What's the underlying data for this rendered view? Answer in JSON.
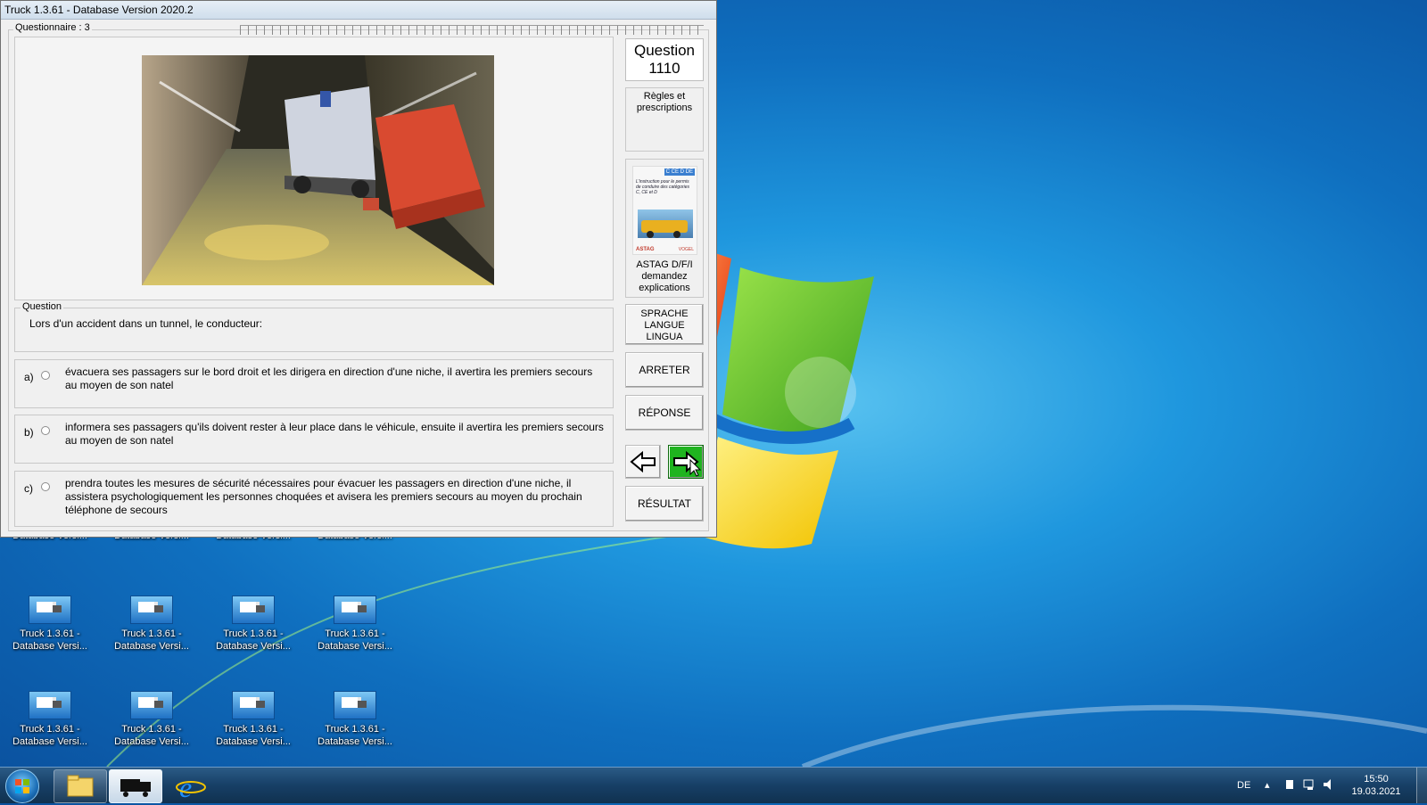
{
  "window": {
    "title": "Truck 1.3.61 - Database Version 2020.2"
  },
  "questionnaire": {
    "label": "Questionnaire : 3"
  },
  "question_panel": {
    "number_label": "Question",
    "number": "1110",
    "category": "Règles et prescriptions",
    "legend": "Question",
    "text": "Lors d'un accident dans un tunnel, le conducteur:"
  },
  "answers": [
    {
      "letter": "a)",
      "text": "évacuera ses passagers sur le bord droit et les dirigera en direction d'une niche, il avertira les premiers secours au moyen de son natel",
      "selected": false
    },
    {
      "letter": "b)",
      "text": "informera ses passagers qu'ils doivent rester à leur place dans le véhicule, ensuite il avertira les premiers secours au moyen de son natel",
      "selected": false
    },
    {
      "letter": "c)",
      "text": "prendra toutes les mesures de sécurité nécessaires pour évacuer les passagers en direction d'une niche, il assistera psychologiquement les personnes choquées et avisera les premiers secours au moyen du prochain téléphone de secours",
      "selected": false
    }
  ],
  "book": {
    "cover_badge": "C CE D DE",
    "cover_text": "L'instruction pour le permis de conduire des catégories C, CE et D",
    "publisher_left": "ASTAG",
    "publisher_right": "VOGEL",
    "caption_1": "ASTAG D/F/I",
    "caption_2": "demandez",
    "caption_3": "explications"
  },
  "buttons": {
    "language_1": "SPRACHE",
    "language_2": "LANGUE",
    "language_3": "LINGUA",
    "stop": "ARRETER",
    "answer": "RÉPONSE",
    "result": "RÉSULTAT"
  },
  "desktop_icons": [
    {
      "line1": "",
      "line2": "Database Versi..."
    },
    {
      "line1": "",
      "line2": "Database Versi..."
    },
    {
      "line1": "",
      "line2": "Database Versi..."
    },
    {
      "line1": "",
      "line2": "Database Versi..."
    },
    {
      "line1": "Truck 1.3.61 -",
      "line2": "Database Versi..."
    },
    {
      "line1": "Truck 1.3.61 -",
      "line2": "Database Versi..."
    },
    {
      "line1": "Truck 1.3.61 -",
      "line2": "Database Versi..."
    },
    {
      "line1": "Truck 1.3.61 -",
      "line2": "Database Versi..."
    },
    {
      "line1": "Truck 1.3.61 -",
      "line2": "Database Versi..."
    },
    {
      "line1": "Truck 1.3.61 -",
      "line2": "Database Versi..."
    },
    {
      "line1": "Truck 1.3.61 -",
      "line2": "Database Versi..."
    },
    {
      "line1": "Truck 1.3.61 -",
      "line2": "Database Versi..."
    }
  ],
  "taskbar": {
    "language": "DE",
    "time": "15:50",
    "date": "19.03.2021"
  },
  "colors": {
    "next_button": "#1fb41f",
    "desktop_blue": "#1f97de"
  }
}
